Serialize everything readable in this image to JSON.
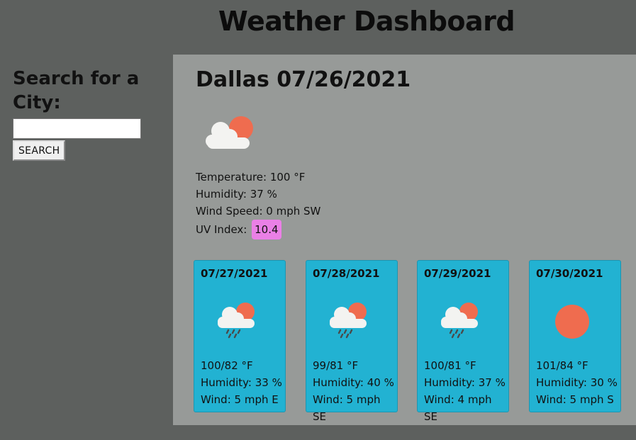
{
  "header": {
    "title": "Weather Dashboard"
  },
  "search": {
    "heading": "Search for a City:",
    "input_value": "",
    "placeholder": "",
    "button_label": "SEARCH"
  },
  "current": {
    "heading": "Dallas 07/26/2021",
    "icon": "cloud-sun-icon",
    "temperature": "Temperature: 100 °F",
    "humidity": "Humidity: 37 %",
    "wind": "Wind Speed: 0 mph SW",
    "uv_label": "UV Index:",
    "uv_value": "10.4",
    "uv_color": "#ea80e6"
  },
  "forecast": [
    {
      "date": "07/27/2021",
      "icon": "rain-cloud-sun-icon",
      "temp": "100/82 °F",
      "humidity": "Humidity: 33 %",
      "wind": "Wind: 5 mph E"
    },
    {
      "date": "07/28/2021",
      "icon": "rain-cloud-sun-icon",
      "temp": "99/81 °F",
      "humidity": "Humidity: 40 %",
      "wind": "Wind: 5 mph SE"
    },
    {
      "date": "07/29/2021",
      "icon": "rain-cloud-sun-icon",
      "temp": "100/81 °F",
      "humidity": "Humidity: 37 %",
      "wind": "Wind: 4 mph SE"
    },
    {
      "date": "07/30/2021",
      "icon": "sun-icon",
      "temp": "101/84 °F",
      "humidity": "Humidity: 30 %",
      "wind": "Wind: 5 mph S"
    }
  ],
  "colors": {
    "card_bg": "#22b2d2",
    "main_bg": "#979a98",
    "page_bg": "#5d605e",
    "sun": "#ef6c4f"
  }
}
